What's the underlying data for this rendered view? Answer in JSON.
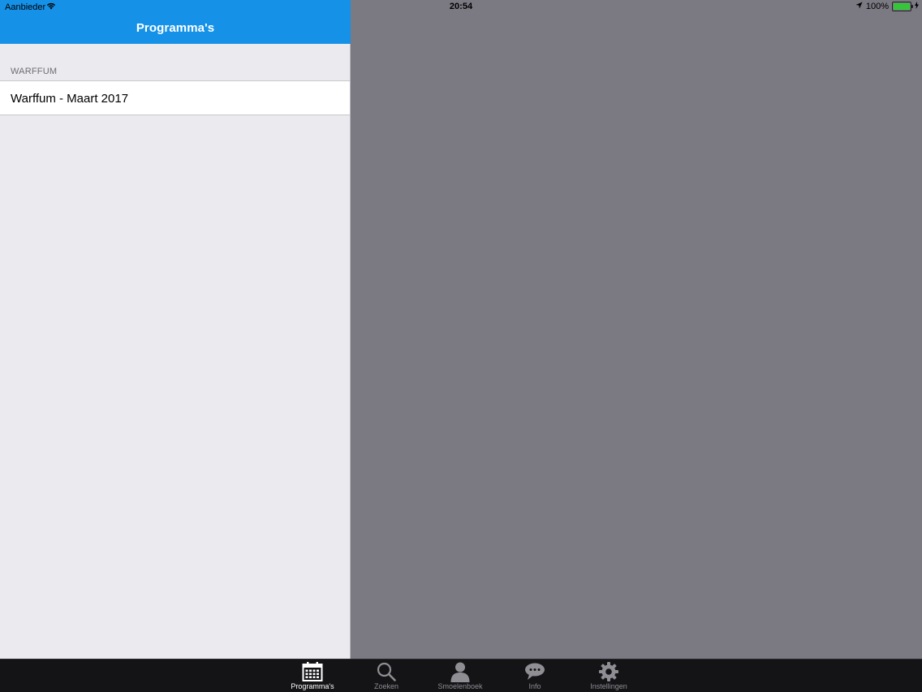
{
  "status_bar": {
    "carrier": "Aanbieder",
    "time": "20:54",
    "battery_percent": "100%",
    "battery_level": 1.0,
    "battery_color": "#35c53b"
  },
  "navbar": {
    "title": "Programma's",
    "color": "#1592e8"
  },
  "table": {
    "section_header": "WARFFUM",
    "rows": [
      {
        "label": "Warffum - Maart 2017"
      }
    ]
  },
  "tabbar": {
    "tabs": [
      {
        "label": "Programma's",
        "icon": "calendar-icon",
        "active": true
      },
      {
        "label": "Zoeken",
        "icon": "search-icon",
        "active": false
      },
      {
        "label": "Smoelenboek",
        "icon": "person-icon",
        "active": false
      },
      {
        "label": "Info",
        "icon": "chat-bubble-icon",
        "active": false
      },
      {
        "label": "Instellingen",
        "icon": "gear-icon",
        "active": false
      }
    ]
  },
  "colors": {
    "master_background": "#ebeaef",
    "detail_background": "#7b7982",
    "tabbar_background": "#141417"
  }
}
